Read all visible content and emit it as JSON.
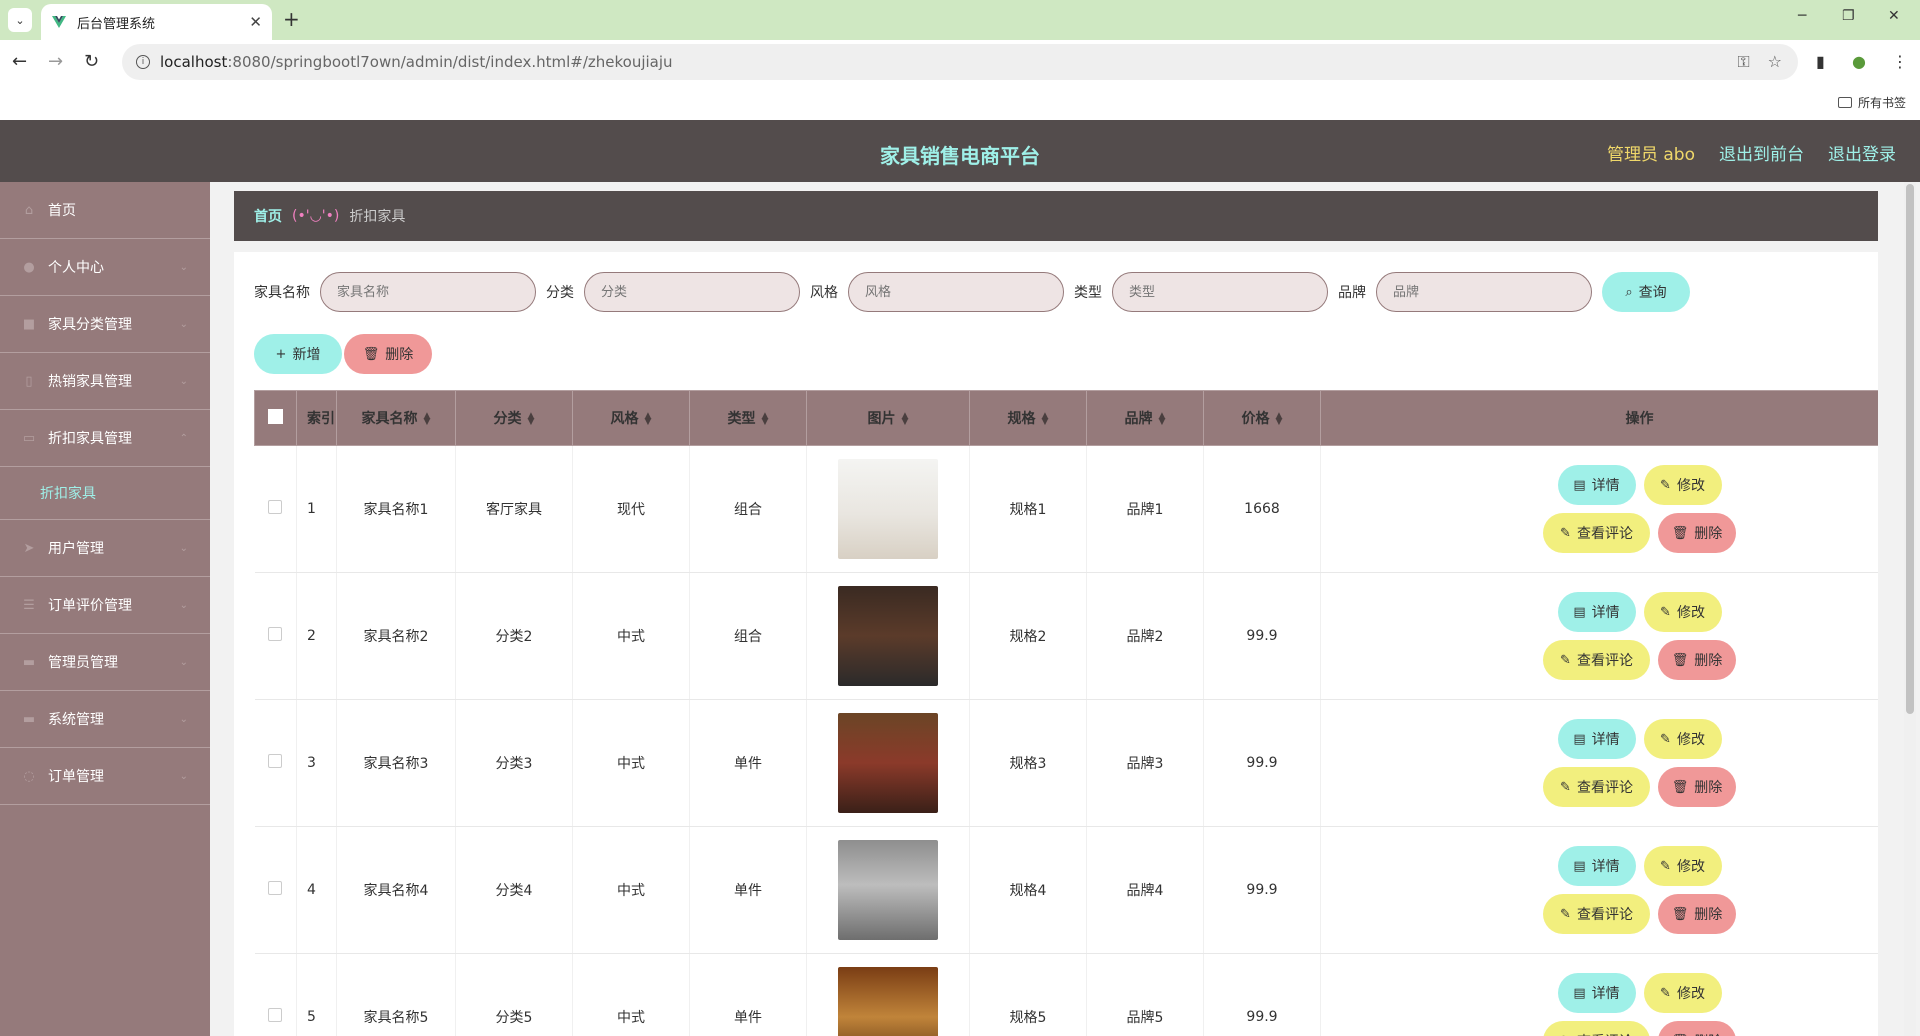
{
  "browser": {
    "tab_title": "后台管理系统",
    "url_host": "localhost",
    "url_path": ":8080/springbootl7own/admin/dist/index.html#/zhekoujiaju",
    "bookmarks_label": "所有书签"
  },
  "header": {
    "title": "家具销售电商平台",
    "admin": "管理员 abo",
    "to_front": "退出到前台",
    "logout": "退出登录"
  },
  "sidebar": {
    "items": [
      {
        "label": "首页",
        "icon": "home-icon"
      },
      {
        "label": "个人中心",
        "icon": "user-icon"
      },
      {
        "label": "家具分类管理",
        "icon": "folder-icon"
      },
      {
        "label": "热销家具管理",
        "icon": "fire-icon"
      },
      {
        "label": "折扣家具管理",
        "icon": "tag-icon"
      },
      {
        "label": "用户管理",
        "icon": "send-icon"
      },
      {
        "label": "订单评价管理",
        "icon": "list-icon"
      },
      {
        "label": "管理员管理",
        "icon": "admin-icon"
      },
      {
        "label": "系统管理",
        "icon": "system-icon"
      },
      {
        "label": "订单管理",
        "icon": "order-icon"
      }
    ],
    "active_sub": "折扣家具"
  },
  "breadcrumb": {
    "home": "首页",
    "sep": "(•'◡'•)",
    "current": "折扣家具"
  },
  "search": {
    "name_label": "家具名称",
    "name_placeholder": "家具名称",
    "cat_label": "分类",
    "cat_placeholder": "分类",
    "style_label": "风格",
    "style_placeholder": "风格",
    "type_label": "类型",
    "type_placeholder": "类型",
    "brand_label": "品牌",
    "brand_placeholder": "品牌",
    "query_btn": "查询"
  },
  "actions": {
    "add": "新增",
    "delete": "删除"
  },
  "table": {
    "headers": [
      "索引",
      "家具名称",
      "分类",
      "风格",
      "类型",
      "图片",
      "规格",
      "品牌",
      "价格",
      "操作"
    ],
    "op_labels": {
      "detail": "详情",
      "edit": "修改",
      "review": "查看评论",
      "delete": "删除"
    },
    "rows": [
      {
        "index": "1",
        "name": "家具名称1",
        "category": "客厅家具",
        "style": "现代",
        "type": "组合",
        "spec": "规格1",
        "brand": "品牌1",
        "price": "1668"
      },
      {
        "index": "2",
        "name": "家具名称2",
        "category": "分类2",
        "style": "中式",
        "type": "组合",
        "spec": "规格2",
        "brand": "品牌2",
        "price": "99.9"
      },
      {
        "index": "3",
        "name": "家具名称3",
        "category": "分类3",
        "style": "中式",
        "type": "单件",
        "spec": "规格3",
        "brand": "品牌3",
        "price": "99.9"
      },
      {
        "index": "4",
        "name": "家具名称4",
        "category": "分类4",
        "style": "中式",
        "type": "单件",
        "spec": "规格4",
        "brand": "品牌4",
        "price": "99.9"
      },
      {
        "index": "5",
        "name": "家具名称5",
        "category": "分类5",
        "style": "中式",
        "type": "单件",
        "spec": "规格5",
        "brand": "品牌5",
        "price": "99.9"
      }
    ]
  },
  "colors": {
    "header_bg": "#534c4c",
    "sidebar_bg": "#957a7b",
    "accent_cyan": "#9ff0e8",
    "accent_yellow": "#f2ef7e",
    "accent_red": "#f09898"
  }
}
